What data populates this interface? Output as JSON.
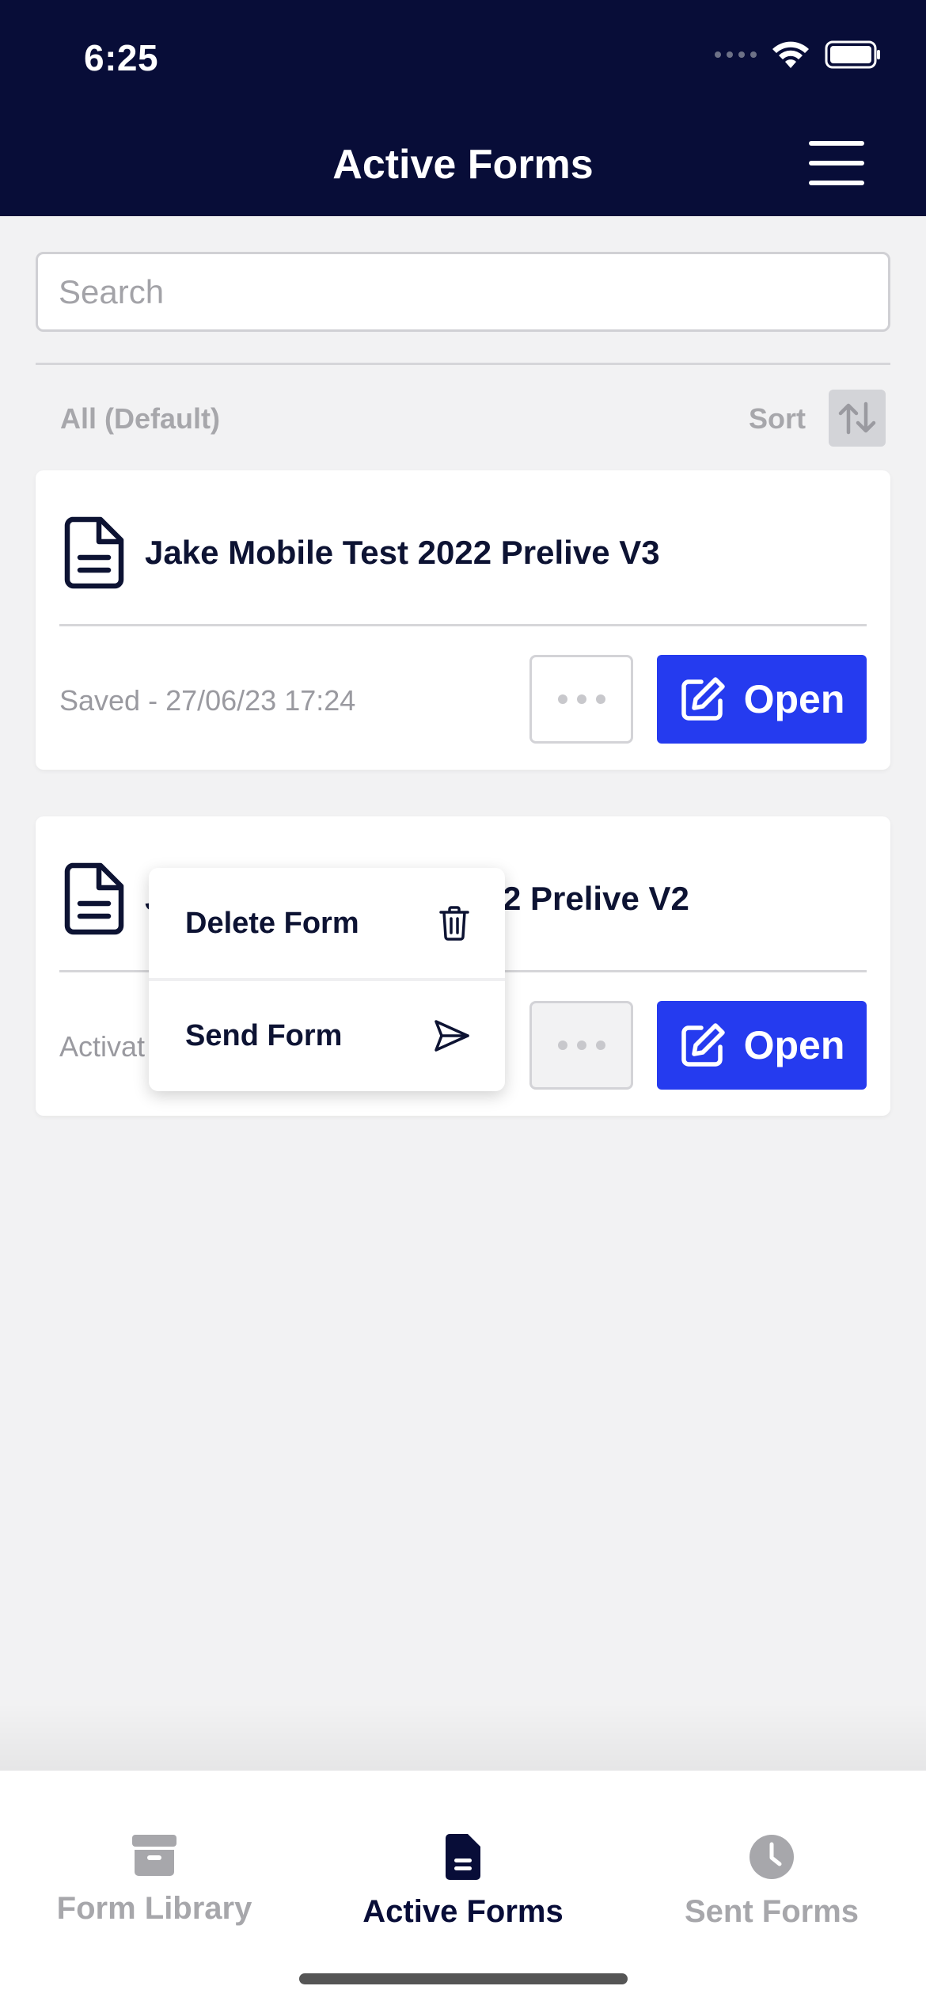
{
  "status_bar": {
    "time": "6:25"
  },
  "header": {
    "title": "Active Forms"
  },
  "search": {
    "placeholder": "Search"
  },
  "filter": {
    "label": "All (Default)",
    "sort_label": "Sort"
  },
  "forms": [
    {
      "title": "Jake Mobile Test 2022 Prelive V3",
      "status": "Saved - 27/06/23 17:24",
      "open_label": "Open"
    },
    {
      "title_visible_part": "2 Prelive V2",
      "title_prefix_visible": "J",
      "status_visible_part": "Activat",
      "open_label": "Open"
    }
  ],
  "context_menu": {
    "items": [
      {
        "label": "Delete Form",
        "icon": "trash-icon"
      },
      {
        "label": "Send Form",
        "icon": "send-icon"
      }
    ]
  },
  "tabbar": {
    "tabs": [
      {
        "label": "Form Library",
        "icon": "archive-box-icon",
        "active": false
      },
      {
        "label": "Active Forms",
        "icon": "document-icon",
        "active": true
      },
      {
        "label": "Sent Forms",
        "icon": "clock-icon",
        "active": false
      }
    ]
  },
  "colors": {
    "header_bg": "#080d38",
    "primary": "#253bef",
    "muted": "#a7a7ab",
    "background": "#f2f2f3"
  }
}
